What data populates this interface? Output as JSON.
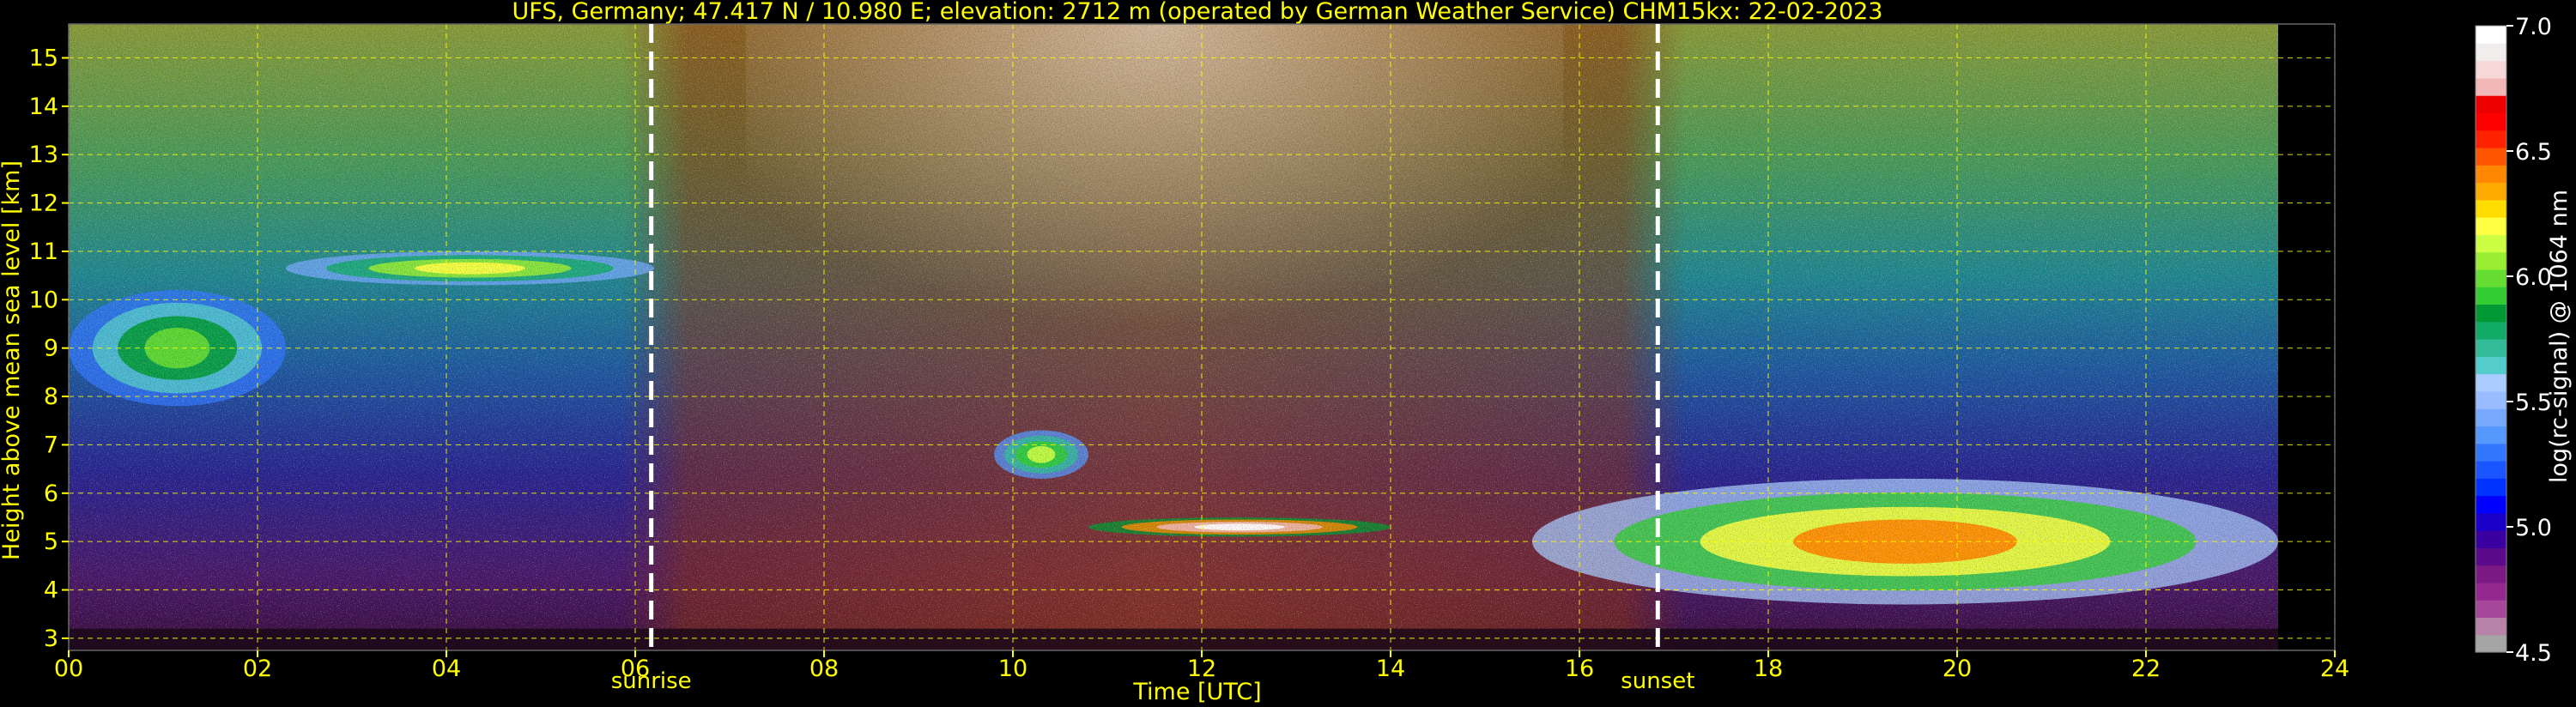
{
  "chart_data": {
    "type": "heatmap",
    "title": "UFS, Germany; 47.417 N / 10.980 E; elevation: 2712 m  (operated by German Weather Service)    CHM15kx: 22-02-2023",
    "xlabel": "Time [UTC]",
    "ylabel": "Height above mean sea level [km]",
    "xlim": [
      0,
      24
    ],
    "ylim": [
      2.75,
      15.7
    ],
    "grid": true,
    "data_end_hour": 23.4,
    "x_ticks": [
      "00",
      "02",
      "04",
      "06",
      "08",
      "10",
      "12",
      "14",
      "16",
      "18",
      "20",
      "22",
      "24"
    ],
    "y_ticks": [
      "3",
      "4",
      "5",
      "6",
      "7",
      "8",
      "9",
      "10",
      "11",
      "12",
      "13",
      "14",
      "15"
    ],
    "events": [
      {
        "label": "sunrise",
        "hour": 6.17
      },
      {
        "label": "sunset",
        "hour": 16.83
      }
    ],
    "colorbar": {
      "label": "log(rc-signal) @ 1064 nm",
      "min": 4.5,
      "max": 7.0,
      "ticks": [
        "4.5",
        "5.0",
        "5.5",
        "6.0",
        "6.5",
        "7.0"
      ],
      "colors": [
        "#a6a6a6",
        "#b783a8",
        "#a7479c",
        "#93288e",
        "#7a1a82",
        "#5a0a8a",
        "#3a00a0",
        "#1a00c8",
        "#0000ff",
        "#0033ff",
        "#1a55ff",
        "#3377ff",
        "#5599ff",
        "#77aaff",
        "#99bbff",
        "#aaccff",
        "#55cccc",
        "#33bb99",
        "#11aa66",
        "#009933",
        "#33cc33",
        "#66dd33",
        "#99ee33",
        "#ccff44",
        "#ffff44",
        "#ffdd00",
        "#ffaa00",
        "#ff8800",
        "#ff5500",
        "#ff2200",
        "#ff0000",
        "#ee0000",
        "#f2b8b8",
        "#f7d8d8",
        "#f2eded",
        "#ffffff"
      ]
    },
    "features": [
      {
        "name": "cirrus-morning",
        "t0": 0.0,
        "t1": 2.3,
        "h0": 7.8,
        "h1": 10.2,
        "level": 6.0
      },
      {
        "name": "cirrus-upper",
        "t0": 2.3,
        "t1": 6.2,
        "h0": 10.3,
        "h1": 11.0,
        "level": 6.2
      },
      {
        "name": "midlevel-cloud",
        "t0": 9.8,
        "t1": 10.8,
        "h0": 6.3,
        "h1": 7.3,
        "level": 6.1
      },
      {
        "name": "cloud-base",
        "t0": 10.8,
        "t1": 14.0,
        "h0": 5.1,
        "h1": 5.5,
        "level": 7.0
      },
      {
        "name": "cloud-evening",
        "t0": 15.5,
        "t1": 23.4,
        "h0": 3.7,
        "h1": 6.3,
        "level": 6.4
      }
    ]
  }
}
